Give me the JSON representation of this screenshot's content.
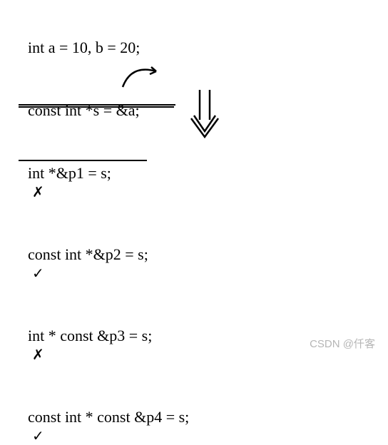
{
  "lines": {
    "l1": "int a = 10, b = 20;",
    "l2": "const int *s = &a;",
    "l3": "int *&p1 = s;",
    "l4": "const int *&p2 = s;",
    "l5": "int * const &p3 = s;",
    "l6": "const int * const &p4 = s;"
  },
  "marks": {
    "wrong1": "✗",
    "correct1": "✓",
    "wrong2": "✗",
    "correct2": "✓"
  },
  "watermark": "CSDN @仟客"
}
